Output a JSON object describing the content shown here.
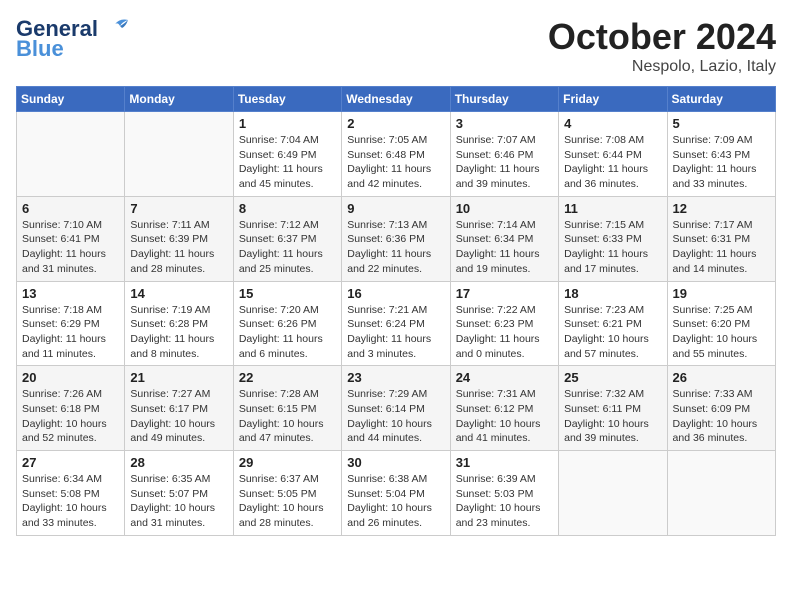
{
  "header": {
    "logo_line1": "General",
    "logo_line2": "Blue",
    "month": "October 2024",
    "location": "Nespolo, Lazio, Italy"
  },
  "weekdays": [
    "Sunday",
    "Monday",
    "Tuesday",
    "Wednesday",
    "Thursday",
    "Friday",
    "Saturday"
  ],
  "weeks": [
    [
      {
        "day": "",
        "info": ""
      },
      {
        "day": "",
        "info": ""
      },
      {
        "day": "1",
        "info": "Sunrise: 7:04 AM\nSunset: 6:49 PM\nDaylight: 11 hours and 45 minutes."
      },
      {
        "day": "2",
        "info": "Sunrise: 7:05 AM\nSunset: 6:48 PM\nDaylight: 11 hours and 42 minutes."
      },
      {
        "day": "3",
        "info": "Sunrise: 7:07 AM\nSunset: 6:46 PM\nDaylight: 11 hours and 39 minutes."
      },
      {
        "day": "4",
        "info": "Sunrise: 7:08 AM\nSunset: 6:44 PM\nDaylight: 11 hours and 36 minutes."
      },
      {
        "day": "5",
        "info": "Sunrise: 7:09 AM\nSunset: 6:43 PM\nDaylight: 11 hours and 33 minutes."
      }
    ],
    [
      {
        "day": "6",
        "info": "Sunrise: 7:10 AM\nSunset: 6:41 PM\nDaylight: 11 hours and 31 minutes."
      },
      {
        "day": "7",
        "info": "Sunrise: 7:11 AM\nSunset: 6:39 PM\nDaylight: 11 hours and 28 minutes."
      },
      {
        "day": "8",
        "info": "Sunrise: 7:12 AM\nSunset: 6:37 PM\nDaylight: 11 hours and 25 minutes."
      },
      {
        "day": "9",
        "info": "Sunrise: 7:13 AM\nSunset: 6:36 PM\nDaylight: 11 hours and 22 minutes."
      },
      {
        "day": "10",
        "info": "Sunrise: 7:14 AM\nSunset: 6:34 PM\nDaylight: 11 hours and 19 minutes."
      },
      {
        "day": "11",
        "info": "Sunrise: 7:15 AM\nSunset: 6:33 PM\nDaylight: 11 hours and 17 minutes."
      },
      {
        "day": "12",
        "info": "Sunrise: 7:17 AM\nSunset: 6:31 PM\nDaylight: 11 hours and 14 minutes."
      }
    ],
    [
      {
        "day": "13",
        "info": "Sunrise: 7:18 AM\nSunset: 6:29 PM\nDaylight: 11 hours and 11 minutes."
      },
      {
        "day": "14",
        "info": "Sunrise: 7:19 AM\nSunset: 6:28 PM\nDaylight: 11 hours and 8 minutes."
      },
      {
        "day": "15",
        "info": "Sunrise: 7:20 AM\nSunset: 6:26 PM\nDaylight: 11 hours and 6 minutes."
      },
      {
        "day": "16",
        "info": "Sunrise: 7:21 AM\nSunset: 6:24 PM\nDaylight: 11 hours and 3 minutes."
      },
      {
        "day": "17",
        "info": "Sunrise: 7:22 AM\nSunset: 6:23 PM\nDaylight: 11 hours and 0 minutes."
      },
      {
        "day": "18",
        "info": "Sunrise: 7:23 AM\nSunset: 6:21 PM\nDaylight: 10 hours and 57 minutes."
      },
      {
        "day": "19",
        "info": "Sunrise: 7:25 AM\nSunset: 6:20 PM\nDaylight: 10 hours and 55 minutes."
      }
    ],
    [
      {
        "day": "20",
        "info": "Sunrise: 7:26 AM\nSunset: 6:18 PM\nDaylight: 10 hours and 52 minutes."
      },
      {
        "day": "21",
        "info": "Sunrise: 7:27 AM\nSunset: 6:17 PM\nDaylight: 10 hours and 49 minutes."
      },
      {
        "day": "22",
        "info": "Sunrise: 7:28 AM\nSunset: 6:15 PM\nDaylight: 10 hours and 47 minutes."
      },
      {
        "day": "23",
        "info": "Sunrise: 7:29 AM\nSunset: 6:14 PM\nDaylight: 10 hours and 44 minutes."
      },
      {
        "day": "24",
        "info": "Sunrise: 7:31 AM\nSunset: 6:12 PM\nDaylight: 10 hours and 41 minutes."
      },
      {
        "day": "25",
        "info": "Sunrise: 7:32 AM\nSunset: 6:11 PM\nDaylight: 10 hours and 39 minutes."
      },
      {
        "day": "26",
        "info": "Sunrise: 7:33 AM\nSunset: 6:09 PM\nDaylight: 10 hours and 36 minutes."
      }
    ],
    [
      {
        "day": "27",
        "info": "Sunrise: 6:34 AM\nSunset: 5:08 PM\nDaylight: 10 hours and 33 minutes."
      },
      {
        "day": "28",
        "info": "Sunrise: 6:35 AM\nSunset: 5:07 PM\nDaylight: 10 hours and 31 minutes."
      },
      {
        "day": "29",
        "info": "Sunrise: 6:37 AM\nSunset: 5:05 PM\nDaylight: 10 hours and 28 minutes."
      },
      {
        "day": "30",
        "info": "Sunrise: 6:38 AM\nSunset: 5:04 PM\nDaylight: 10 hours and 26 minutes."
      },
      {
        "day": "31",
        "info": "Sunrise: 6:39 AM\nSunset: 5:03 PM\nDaylight: 10 hours and 23 minutes."
      },
      {
        "day": "",
        "info": ""
      },
      {
        "day": "",
        "info": ""
      }
    ]
  ]
}
